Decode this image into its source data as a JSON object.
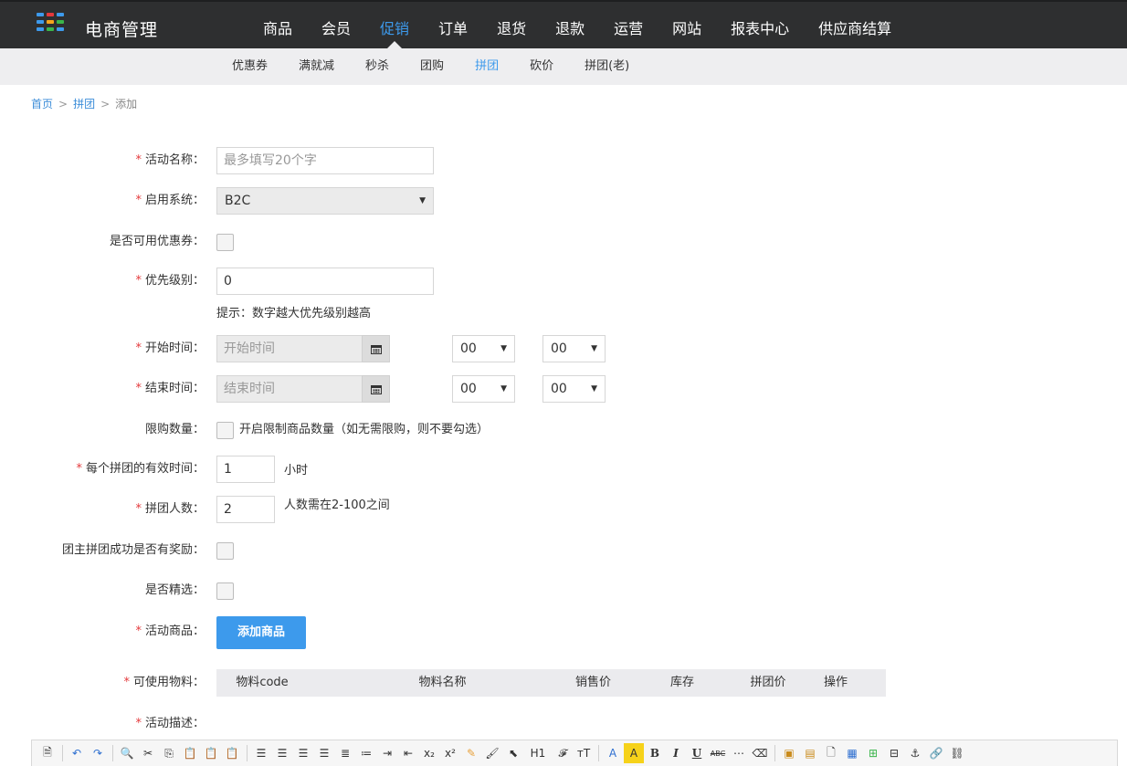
{
  "app": {
    "brand": "电商管理",
    "logo_colors": [
      "#3d9aec",
      "#e4393c",
      "#3ab54a",
      "#f7a51c"
    ]
  },
  "main_nav": [
    {
      "label": "商品",
      "active": false
    },
    {
      "label": "会员",
      "active": false
    },
    {
      "label": "促销",
      "active": true
    },
    {
      "label": "订单",
      "active": false
    },
    {
      "label": "退货",
      "active": false
    },
    {
      "label": "退款",
      "active": false
    },
    {
      "label": "运营",
      "active": false
    },
    {
      "label": "网站",
      "active": false
    },
    {
      "label": "报表中心",
      "active": false
    },
    {
      "label": "供应商结算",
      "active": false
    }
  ],
  "sub_nav": [
    {
      "label": "优惠券",
      "active": false
    },
    {
      "label": "满就减",
      "active": false
    },
    {
      "label": "秒杀",
      "active": false
    },
    {
      "label": "团购",
      "active": false
    },
    {
      "label": "拼团",
      "active": true
    },
    {
      "label": "砍价",
      "active": false
    },
    {
      "label": "拼团(老)",
      "active": false
    }
  ],
  "breadcrumb": {
    "home": "首页",
    "section": "拼团",
    "current": "添加",
    "separator": ">"
  },
  "form": {
    "required_mark": "*",
    "activity_name": {
      "label": "活动名称：",
      "placeholder": "最多填写20个字",
      "value": ""
    },
    "system": {
      "label": "启用系统：",
      "value": "B2C"
    },
    "coupon": {
      "label": "是否可用优惠券："
    },
    "priority": {
      "label": "优先级别：",
      "value": "0",
      "hint": "提示：数字越大优先级别越高"
    },
    "start_time": {
      "label": "开始时间：",
      "placeholder": "开始时间",
      "hour": "00",
      "minute": "00"
    },
    "end_time": {
      "label": "结束时间：",
      "placeholder": "结束时间",
      "hour": "00",
      "minute": "00"
    },
    "limit": {
      "label": "限购数量：",
      "checkbox_text": "开启限制商品数量（如无需限购，则不要勾选）"
    },
    "valid_time": {
      "label": "每个拼团的有效时间：",
      "value": "1",
      "unit": "小时"
    },
    "group_size": {
      "label": "拼团人数：",
      "value": "2",
      "hint": "人数需在2-100之间"
    },
    "leader_reward": {
      "label": "团主拼团成功是否有奖励："
    },
    "featured": {
      "label": "是否精选："
    },
    "products": {
      "label": "活动商品：",
      "button": "添加商品"
    },
    "materials": {
      "label": "可使用物料：",
      "columns": [
        "物料code",
        "物料名称",
        "销售价",
        "库存",
        "拼团价",
        "操作"
      ]
    },
    "description": {
      "label": "活动描述："
    }
  },
  "editor_toolbar": {
    "heading": "H1",
    "font": "𝓕",
    "size": "тT",
    "font_color": "A",
    "bg_color": "A",
    "bold": "B",
    "italic": "I",
    "underline": "U",
    "strike": "ABC"
  }
}
